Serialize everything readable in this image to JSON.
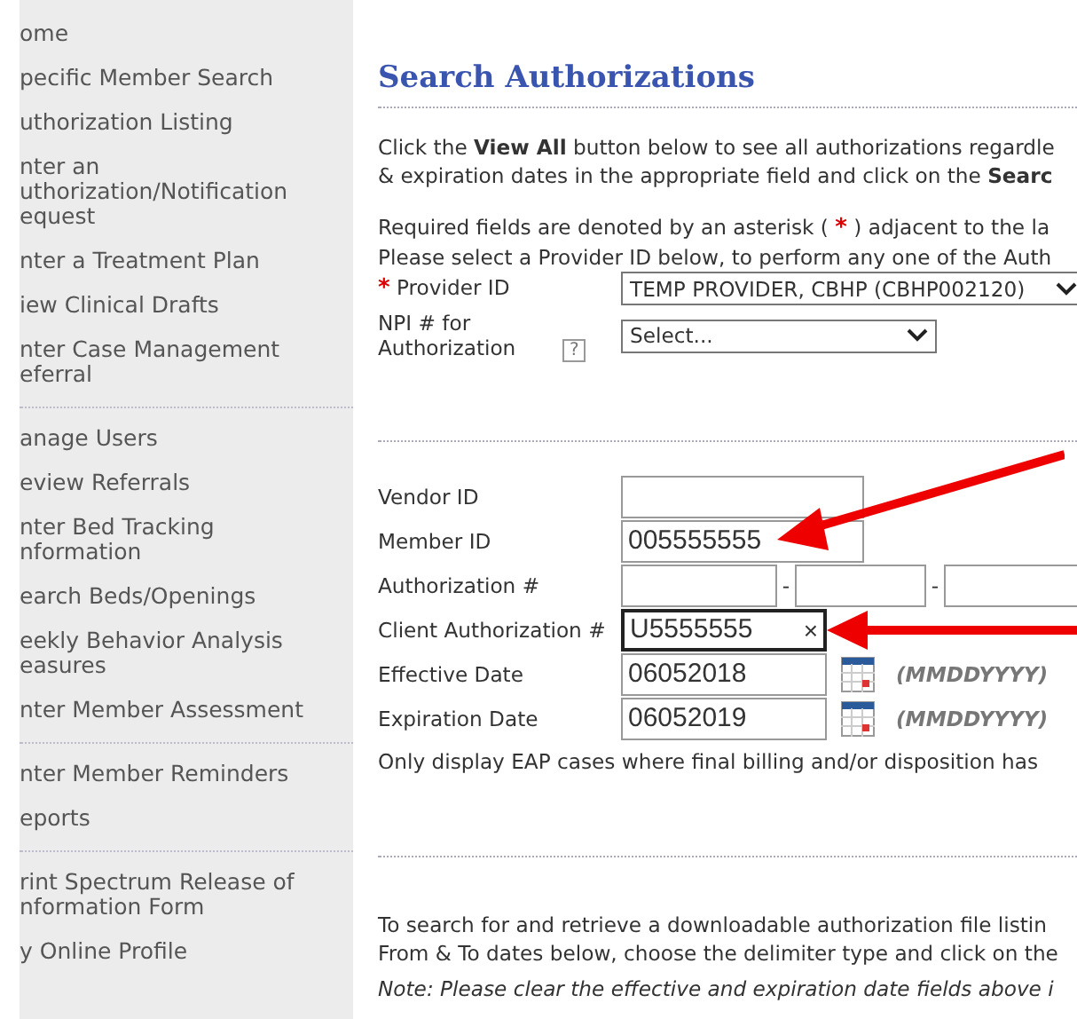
{
  "sidebar": {
    "items": [
      {
        "lines": [
          "ome"
        ],
        "divider_after": false
      },
      {
        "lines": [
          "pecific Member Search"
        ],
        "divider_after": false
      },
      {
        "lines": [
          "uthorization Listing"
        ],
        "divider_after": false
      },
      {
        "lines": [
          "nter an",
          "uthorization/Notification",
          "equest"
        ],
        "divider_after": false
      },
      {
        "lines": [
          "nter a Treatment Plan"
        ],
        "divider_after": false
      },
      {
        "lines": [
          "iew Clinical Drafts"
        ],
        "divider_after": false
      },
      {
        "lines": [
          "nter Case Management",
          "eferral"
        ],
        "divider_after": true
      },
      {
        "lines": [
          "anage Users"
        ],
        "divider_after": false
      },
      {
        "lines": [
          "eview Referrals"
        ],
        "divider_after": false
      },
      {
        "lines": [
          "nter Bed Tracking",
          "nformation"
        ],
        "divider_after": false
      },
      {
        "lines": [
          "earch Beds/Openings"
        ],
        "divider_after": false
      },
      {
        "lines": [
          "eekly Behavior Analysis",
          "easures"
        ],
        "divider_after": false
      },
      {
        "lines": [
          "nter Member Assessment"
        ],
        "divider_after": true
      },
      {
        "lines": [
          "nter Member Reminders"
        ],
        "divider_after": false
      },
      {
        "lines": [
          "eports"
        ],
        "divider_after": true
      },
      {
        "lines": [
          "rint Spectrum Release of",
          "nformation Form"
        ],
        "divider_after": false
      },
      {
        "lines": [
          "y Online Profile"
        ],
        "divider_after": false
      }
    ]
  },
  "title": "Search Authorizations",
  "intro": [
    "Click the **View All** button below to see all authorizations regardle",
    "& expiration dates in the appropriate field and click on the **Searc**"
  ],
  "required_note": {
    "before": "Required fields are denoted by an asterisk (",
    "mark": "*",
    "after": ") adjacent to the la"
  },
  "provider_note": "Please select a Provider ID below, to perform any one of the Auth",
  "selects": [
    {
      "label": "Provider ID",
      "required": true,
      "value": "TEMP PROVIDER, CBHP (CBHP002120)"
    },
    {
      "label": "NPI # for Authorization",
      "required": false,
      "value": "Select...",
      "help": "?"
    }
  ],
  "fields": [
    {
      "kind": "text",
      "label": "Vendor ID",
      "arrow": false
    },
    {
      "kind": "text",
      "label": "Member ID",
      "value": "005555555",
      "arrow": true
    },
    {
      "kind": "segmented",
      "label": "Authorization #",
      "separators": [
        "-",
        "-"
      ],
      "arrow": false
    },
    {
      "kind": "clearable",
      "label": "Client Authorization #",
      "value": "U5555555",
      "clear": "×",
      "focused": true,
      "arrow": true
    },
    {
      "kind": "date",
      "label": "Effective Date",
      "value": "06052018",
      "hint": "(MMDDYYYY)",
      "arrow": false
    },
    {
      "kind": "date",
      "label": "Expiration Date",
      "value": "06052019",
      "hint": "(MMDDYYYY)",
      "arrow": false
    }
  ],
  "eap_note": "Only display EAP cases where final billing and/or disposition has",
  "download_text": [
    "To search for and retrieve a downloadable authorization file listin",
    "From & To dates below, choose the delimiter type and click on the"
  ],
  "note": "Note: Please clear the effective and expiration date fields above i"
}
